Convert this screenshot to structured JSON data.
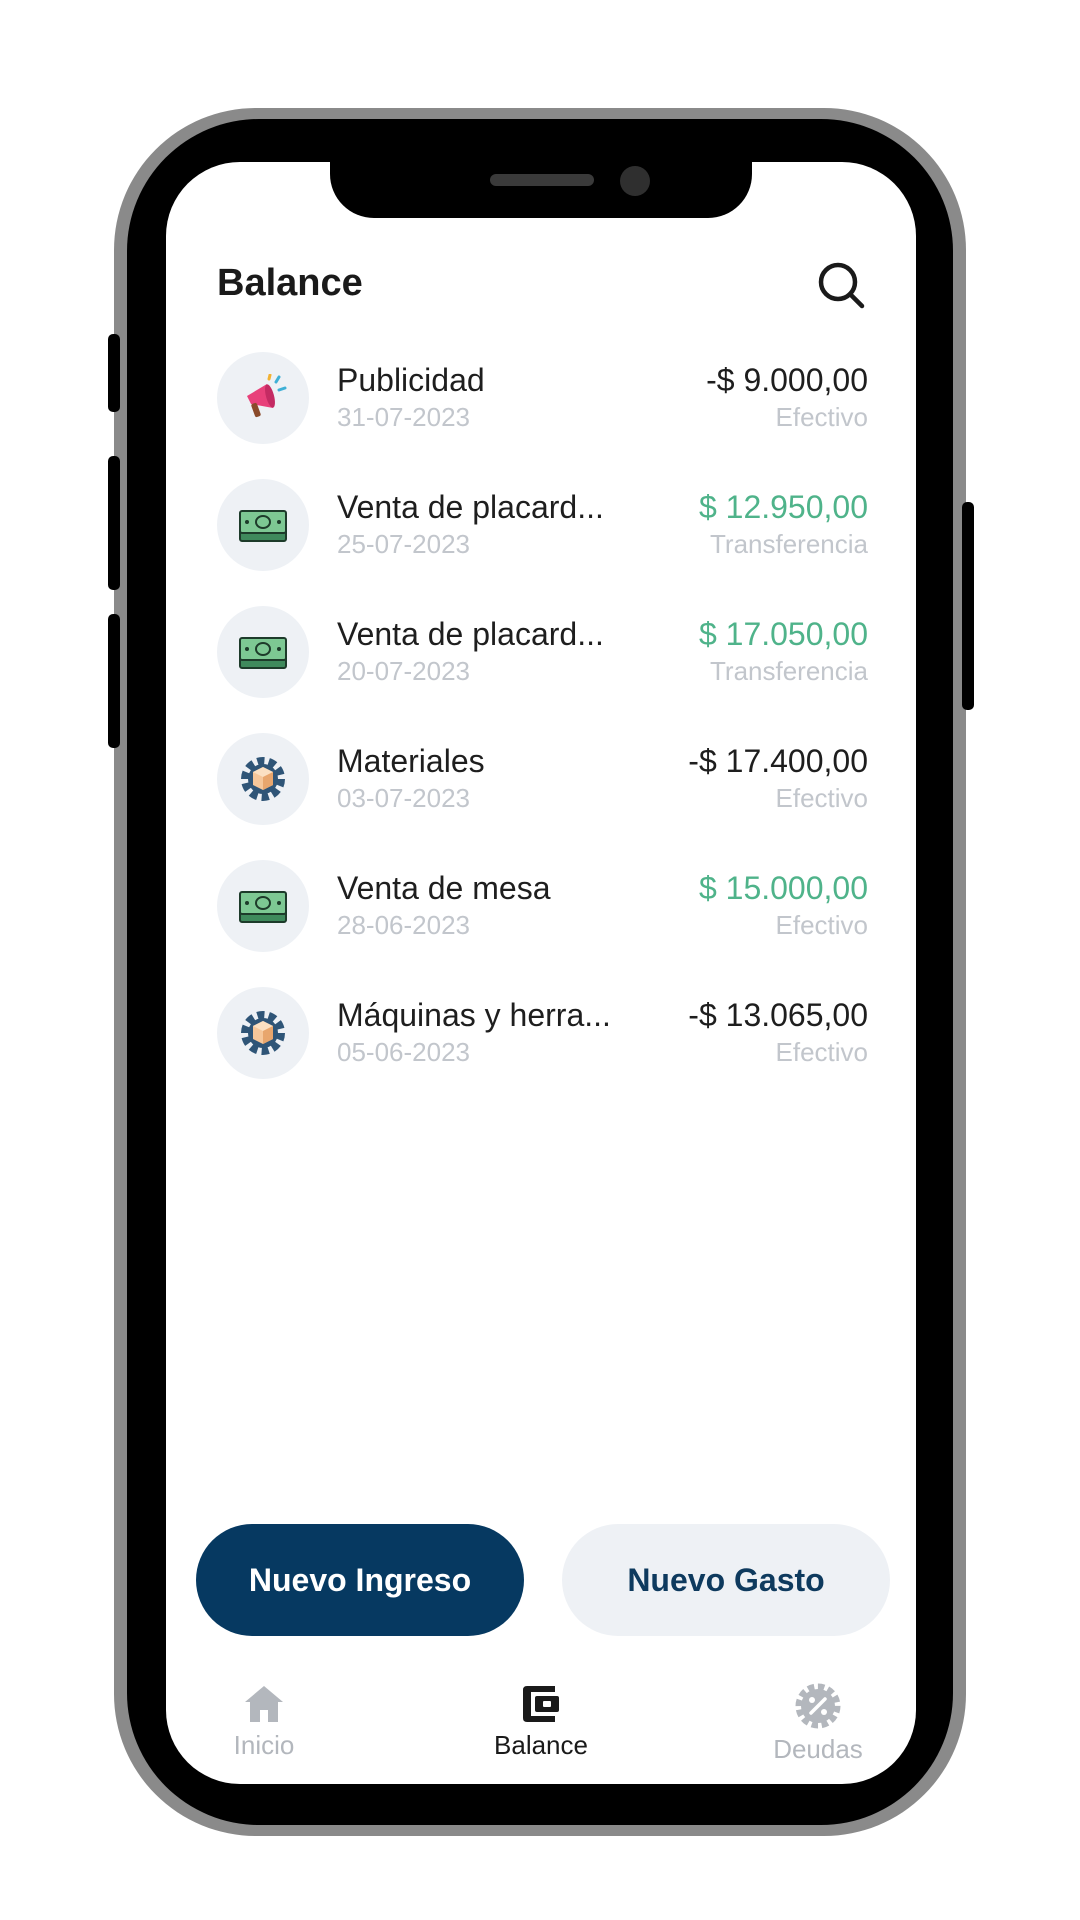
{
  "header": {
    "title": "Balance"
  },
  "transactions": [
    {
      "title": "Publicidad",
      "date": "31-07-2023",
      "amount": "-$ 9.000,00",
      "method": "Efectivo",
      "type": "expense",
      "icon": "megaphone-icon"
    },
    {
      "title": "Venta de placard...",
      "date": "25-07-2023",
      "amount": "$ 12.950,00",
      "method": "Transferencia",
      "type": "income",
      "icon": "cash-icon"
    },
    {
      "title": "Venta de placard...",
      "date": "20-07-2023",
      "amount": "$ 17.050,00",
      "method": "Transferencia",
      "type": "income",
      "icon": "cash-icon"
    },
    {
      "title": "Materiales",
      "date": "03-07-2023",
      "amount": "-$ 17.400,00",
      "method": "Efectivo",
      "type": "expense",
      "icon": "box-gear-icon"
    },
    {
      "title": "Venta de mesa",
      "date": "28-06-2023",
      "amount": "$ 15.000,00",
      "method": "Efectivo",
      "type": "income",
      "icon": "cash-icon"
    },
    {
      "title": "Máquinas y herra...",
      "date": "05-06-2023",
      "amount": "-$ 13.065,00",
      "method": "Efectivo",
      "type": "expense",
      "icon": "box-gear-icon"
    }
  ],
  "actions": {
    "new_income": "Nuevo Ingreso",
    "new_expense": "Nuevo Gasto"
  },
  "nav": {
    "items": [
      {
        "label": "Inicio",
        "icon": "home-icon",
        "active": false
      },
      {
        "label": "Balance",
        "icon": "wallet-icon",
        "active": true
      },
      {
        "label": "Deudas",
        "icon": "discount-badge-icon",
        "active": false
      }
    ]
  },
  "colors": {
    "primary": "#063961",
    "income": "#4fb38a",
    "expense": "#1e1e1e",
    "muted": "#c2c6cc",
    "icon_bg": "#eef1f5"
  }
}
